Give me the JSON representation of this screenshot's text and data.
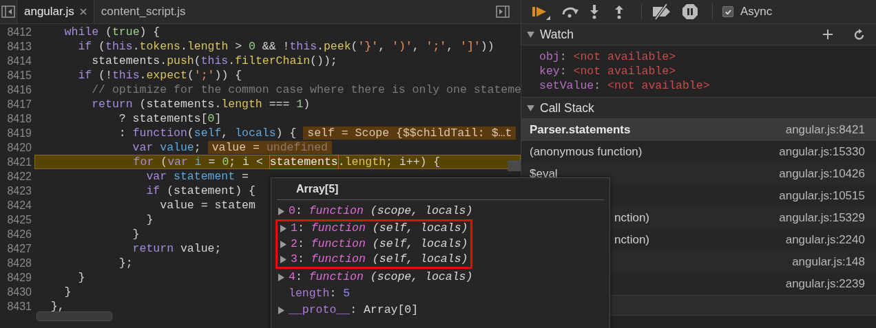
{
  "editor": {
    "tabs": [
      {
        "label": "angular.js",
        "selected": true,
        "closable": true
      },
      {
        "label": "content_script.js",
        "selected": false,
        "closable": false
      }
    ],
    "lines": [
      {
        "number": "8412",
        "tokens": [
          {
            "kind": "keyword",
            "text": "    while"
          },
          {
            "kind": "plain",
            "text": " ("
          },
          {
            "kind": "number",
            "text": "true"
          },
          {
            "kind": "plain",
            "text": ") {"
          }
        ]
      },
      {
        "number": "8413",
        "tokens": [
          {
            "kind": "keyword",
            "text": "      if"
          },
          {
            "kind": "plain",
            "text": " ("
          },
          {
            "kind": "keyword",
            "text": "this"
          },
          {
            "kind": "plain",
            "text": "."
          },
          {
            "kind": "property",
            "text": "tokens"
          },
          {
            "kind": "plain",
            "text": "."
          },
          {
            "kind": "property",
            "text": "length"
          },
          {
            "kind": "plain",
            "text": " > "
          },
          {
            "kind": "number",
            "text": "0"
          },
          {
            "kind": "plain",
            "text": " && !"
          },
          {
            "kind": "keyword",
            "text": "this"
          },
          {
            "kind": "plain",
            "text": "."
          },
          {
            "kind": "property",
            "text": "peek"
          },
          {
            "kind": "plain",
            "text": "("
          },
          {
            "kind": "string",
            "text": "'}'"
          },
          {
            "kind": "plain",
            "text": ", "
          },
          {
            "kind": "string",
            "text": "')'"
          },
          {
            "kind": "plain",
            "text": ", "
          },
          {
            "kind": "string",
            "text": "';'"
          },
          {
            "kind": "plain",
            "text": ", "
          },
          {
            "kind": "string",
            "text": "']'"
          },
          {
            "kind": "plain",
            "text": "))"
          }
        ]
      },
      {
        "number": "8414",
        "tokens": [
          {
            "kind": "plain",
            "text": "        statements."
          },
          {
            "kind": "property",
            "text": "push"
          },
          {
            "kind": "plain",
            "text": "("
          },
          {
            "kind": "keyword",
            "text": "this"
          },
          {
            "kind": "plain",
            "text": "."
          },
          {
            "kind": "property",
            "text": "filterChain"
          },
          {
            "kind": "plain",
            "text": "());"
          }
        ]
      },
      {
        "number": "8415",
        "tokens": [
          {
            "kind": "keyword",
            "text": "      if"
          },
          {
            "kind": "plain",
            "text": " (!"
          },
          {
            "kind": "keyword",
            "text": "this"
          },
          {
            "kind": "plain",
            "text": "."
          },
          {
            "kind": "property",
            "text": "expect"
          },
          {
            "kind": "plain",
            "text": "("
          },
          {
            "kind": "string",
            "text": "';'"
          },
          {
            "kind": "plain",
            "text": ")) {"
          }
        ]
      },
      {
        "number": "8416",
        "tokens": [
          {
            "kind": "comment",
            "text": "        // optimize for the common case where there is only one stateme"
          }
        ]
      },
      {
        "number": "8417",
        "tokens": [
          {
            "kind": "keyword",
            "text": "        return"
          },
          {
            "kind": "plain",
            "text": " (statements."
          },
          {
            "kind": "property",
            "text": "length"
          },
          {
            "kind": "plain",
            "text": " === "
          },
          {
            "kind": "number",
            "text": "1"
          },
          {
            "kind": "plain",
            "text": ")"
          }
        ]
      },
      {
        "number": "8418",
        "tokens": [
          {
            "kind": "plain",
            "text": "            ? statements["
          },
          {
            "kind": "number",
            "text": "0"
          },
          {
            "kind": "plain",
            "text": "]"
          }
        ]
      },
      {
        "number": "8419",
        "tokens": [
          {
            "kind": "plain",
            "text": "            : "
          },
          {
            "kind": "keyword",
            "text": "function"
          },
          {
            "kind": "plain",
            "text": "("
          },
          {
            "kind": "variable",
            "text": "self"
          },
          {
            "kind": "plain",
            "text": ", "
          },
          {
            "kind": "variable",
            "text": "locals"
          },
          {
            "kind": "plain",
            "text": ") {"
          }
        ],
        "inline_value": {
          "text": "self = Scope {$$childTail: $…t"
        }
      },
      {
        "number": "8420",
        "tokens": [
          {
            "kind": "keyword",
            "text": "              var "
          },
          {
            "kind": "variable",
            "text": "value"
          },
          {
            "kind": "plain",
            "text": ";"
          }
        ],
        "inline_value": {
          "text": "value = ",
          "undefined_text": "undefined"
        }
      },
      {
        "number": "8421",
        "current": true,
        "tokens": [
          {
            "kind": "keyword",
            "text": "              for"
          },
          {
            "kind": "plain",
            "text": " ("
          },
          {
            "kind": "keyword",
            "text": "var "
          },
          {
            "kind": "variable",
            "text": "i"
          },
          {
            "kind": "plain",
            "text": " = "
          },
          {
            "kind": "number",
            "text": "0"
          },
          {
            "kind": "plain",
            "text": "; i < "
          },
          {
            "kind": "hovered",
            "text": "statements"
          },
          {
            "kind": "plain",
            "text": "."
          },
          {
            "kind": "property",
            "text": "length"
          },
          {
            "kind": "plain",
            "text": "; i++) {"
          }
        ]
      },
      {
        "number": "8422",
        "tokens": [
          {
            "kind": "keyword",
            "text": "                var "
          },
          {
            "kind": "variable",
            "text": "statement"
          },
          {
            "kind": "plain",
            "text": " ="
          }
        ]
      },
      {
        "number": "8423",
        "tokens": [
          {
            "kind": "keyword",
            "text": "                if"
          },
          {
            "kind": "plain",
            "text": " (statement) {"
          }
        ]
      },
      {
        "number": "8424",
        "tokens": [
          {
            "kind": "plain",
            "text": "                  value = statem"
          }
        ]
      },
      {
        "number": "8425",
        "tokens": [
          {
            "kind": "plain",
            "text": "                }"
          }
        ]
      },
      {
        "number": "8426",
        "tokens": [
          {
            "kind": "plain",
            "text": "              }"
          }
        ]
      },
      {
        "number": "8427",
        "tokens": [
          {
            "kind": "keyword",
            "text": "              return"
          },
          {
            "kind": "plain",
            "text": " value;"
          }
        ]
      },
      {
        "number": "8428",
        "tokens": [
          {
            "kind": "plain",
            "text": "            };"
          }
        ]
      },
      {
        "number": "8429",
        "tokens": [
          {
            "kind": "plain",
            "text": "      }"
          }
        ]
      },
      {
        "number": "8430",
        "tokens": [
          {
            "kind": "plain",
            "text": "    }"
          }
        ]
      },
      {
        "number": "8431",
        "tokens": [
          {
            "kind": "plain",
            "text": "  },"
          }
        ]
      }
    ]
  },
  "popover": {
    "title": "Array[5]",
    "properties": [
      {
        "name": "0",
        "separator": ":",
        "kind": "function",
        "value": "function",
        "params": "(scope, locals)",
        "expandable": true,
        "highlighted": false
      },
      {
        "name": "1",
        "separator": ":",
        "kind": "function",
        "value": "function",
        "params": "(self, locals)",
        "expandable": true,
        "highlighted": true
      },
      {
        "name": "2",
        "separator": ":",
        "kind": "function",
        "value": "function",
        "params": "(self, locals)",
        "expandable": true,
        "highlighted": true
      },
      {
        "name": "3",
        "separator": ":",
        "kind": "function",
        "value": "function",
        "params": "(self, locals)",
        "expandable": true,
        "highlighted": true
      },
      {
        "name": "4",
        "separator": ":",
        "kind": "function",
        "value": "function",
        "params": "(scope, locals)",
        "expandable": true,
        "highlighted": false
      },
      {
        "name": "length",
        "separator": ":",
        "kind": "number",
        "value": "5",
        "expandable": false,
        "highlighted": false
      },
      {
        "name": "__proto__",
        "separator": ":",
        "kind": "object",
        "value": "Array[0]",
        "expandable": true,
        "highlighted": false
      }
    ]
  },
  "debugger": {
    "async": {
      "label": "Async",
      "checked": true
    },
    "watch": {
      "title": "Watch",
      "expanded": true,
      "items": [
        {
          "name": "obj",
          "separator": ":",
          "value": "<not available>"
        },
        {
          "name": "key",
          "separator": ":",
          "value": "<not available>"
        },
        {
          "name": "setValue",
          "separator": ":",
          "value": "<not available>"
        }
      ]
    },
    "call_stack": {
      "title": "Call Stack",
      "expanded": true,
      "frames": [
        {
          "function": "Parser.statements",
          "location": "angular.js:8421",
          "selected": true,
          "cut_off": false
        },
        {
          "function": "(anonymous function)",
          "location": "angular.js:15330",
          "selected": false,
          "cut_off": false
        },
        {
          "function": "$eval",
          "location": "angular.js:10426",
          "selected": false,
          "cut_off": false
        },
        {
          "location": "angular.js:10515",
          "selected": false
        },
        {
          "function": "nction)",
          "location": "angular.js:15329",
          "selected": false,
          "cut_off": true
        },
        {
          "function": "nction)",
          "location": "angular.js:2240",
          "selected": false,
          "cut_off": true
        },
        {
          "location": "angular.js:148",
          "selected": false
        },
        {
          "location": "angular.js:2239",
          "selected": false
        }
      ]
    }
  }
}
